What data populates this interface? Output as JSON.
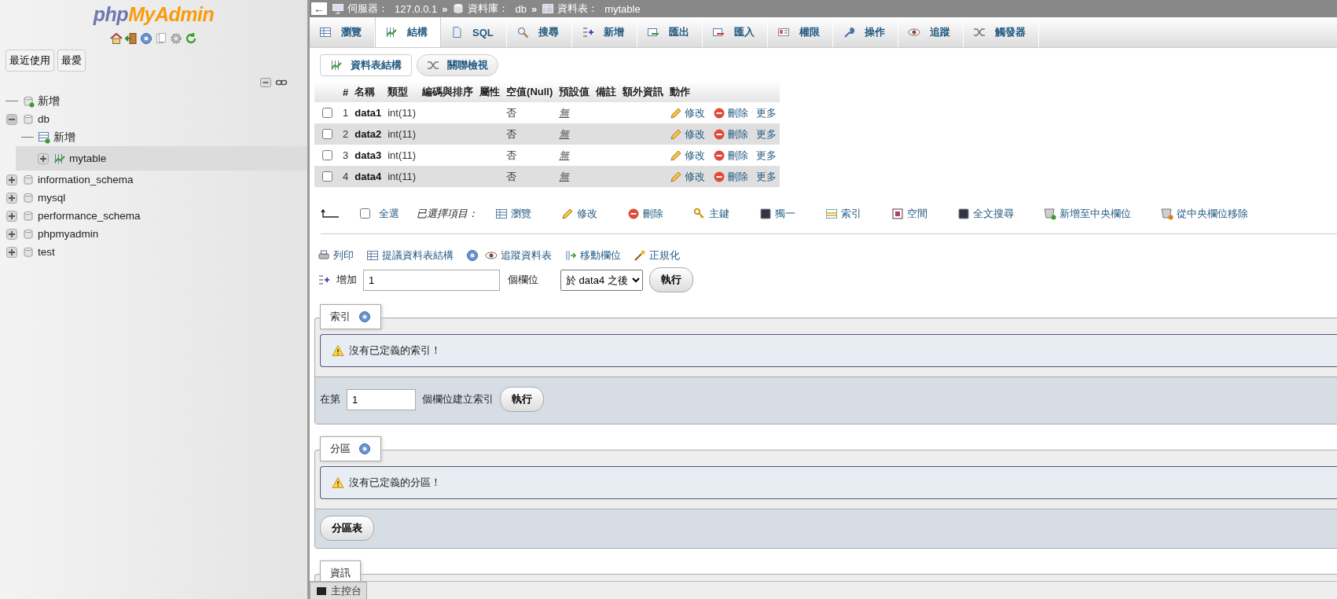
{
  "sidebar": {
    "logo": [
      "php",
      "MyAdmin"
    ],
    "buttons": [
      "最近使用",
      "最愛"
    ],
    "tree": [
      {
        "label": "新增",
        "kind": "new",
        "selected": false
      },
      {
        "label": "db",
        "kind": "database",
        "expanded": true,
        "selected": false,
        "children": [
          {
            "label": "新增",
            "kind": "new",
            "selected": false
          },
          {
            "label": "mytable",
            "kind": "table",
            "expanded": false,
            "selected": true
          }
        ]
      },
      {
        "label": "information_schema",
        "kind": "database",
        "expanded": false,
        "selected": false
      },
      {
        "label": "mysql",
        "kind": "database",
        "expanded": false,
        "selected": false
      },
      {
        "label": "performance_schema",
        "kind": "database",
        "expanded": false,
        "selected": false
      },
      {
        "label": "phpmyadmin",
        "kind": "database",
        "expanded": false,
        "selected": false
      },
      {
        "label": "test",
        "kind": "database",
        "expanded": false,
        "selected": false
      }
    ]
  },
  "breadcrumb": {
    "back": "←",
    "items": [
      {
        "label": "伺服器：",
        "value": "127.0.0.1"
      },
      {
        "label": "資料庫：",
        "value": "db"
      },
      {
        "label": "資料表：",
        "value": "mytable"
      }
    ],
    "separators": [
      "»",
      "»"
    ]
  },
  "tabs": [
    {
      "label": "瀏覽",
      "selected": false
    },
    {
      "label": "結構",
      "selected": true
    },
    {
      "label": "SQL",
      "selected": false
    },
    {
      "label": "搜尋",
      "selected": false
    },
    {
      "label": "新增",
      "selected": false
    },
    {
      "label": "匯出",
      "selected": false
    },
    {
      "label": "匯入",
      "selected": false
    },
    {
      "label": "權限",
      "selected": false
    },
    {
      "label": "操作",
      "selected": false
    },
    {
      "label": "追蹤",
      "selected": false
    },
    {
      "label": "觸發器",
      "selected": false
    }
  ],
  "subtabs": [
    {
      "label": "資料表結構",
      "selected": true
    },
    {
      "label": "關聯檢視",
      "selected": false
    }
  ],
  "table": {
    "columns": [
      "#",
      "名稱",
      "類型",
      "編碼與排序",
      "屬性",
      "空值(Null)",
      "預設值",
      "備註",
      "額外資訊",
      "動作"
    ],
    "rows": [
      {
        "checked": false,
        "num": "1",
        "name": "data1",
        "type": "int(11)",
        "null": "否",
        "default": "無",
        "actions": [
          "修改",
          "刪除",
          "更多"
        ]
      },
      {
        "checked": false,
        "num": "2",
        "name": "data2",
        "type": "int(11)",
        "null": "否",
        "default": "無",
        "actions": [
          "修改",
          "刪除",
          "更多"
        ]
      },
      {
        "checked": false,
        "num": "3",
        "name": "data3",
        "type": "int(11)",
        "null": "否",
        "default": "無",
        "actions": [
          "修改",
          "刪除",
          "更多"
        ]
      },
      {
        "checked": false,
        "num": "4",
        "name": "data4",
        "type": "int(11)",
        "null": "否",
        "default": "無",
        "actions": [
          "修改",
          "刪除",
          "更多"
        ]
      }
    ]
  },
  "bulk": {
    "check_all": {
      "label": "全選",
      "checked": false
    },
    "with_selected": "已選擇項目：",
    "actions": [
      "瀏覽",
      "修改",
      "刪除",
      "主鍵",
      "獨一",
      "索引",
      "空間",
      "全文搜尋",
      "新增至中央欄位",
      "從中央欄位移除"
    ]
  },
  "links": [
    "列印",
    "提議資料表結構",
    "追蹤資料表",
    "移動欄位",
    "正規化"
  ],
  "add_columns": {
    "label": "增加",
    "value": "1",
    "unit": "個欄位",
    "position": "於 data4 之後",
    "button": "執行"
  },
  "indexes": {
    "legend": "索引",
    "message": "沒有已定義的索引！",
    "prefix": "在第",
    "value": "1",
    "suffix": "個欄位建立索引",
    "button": "執行"
  },
  "partitions": {
    "legend": "分區",
    "message": "沒有已定義的分區！",
    "button": "分區表"
  },
  "information": {
    "legend": "資訊"
  },
  "console": {
    "label": "主控台"
  }
}
